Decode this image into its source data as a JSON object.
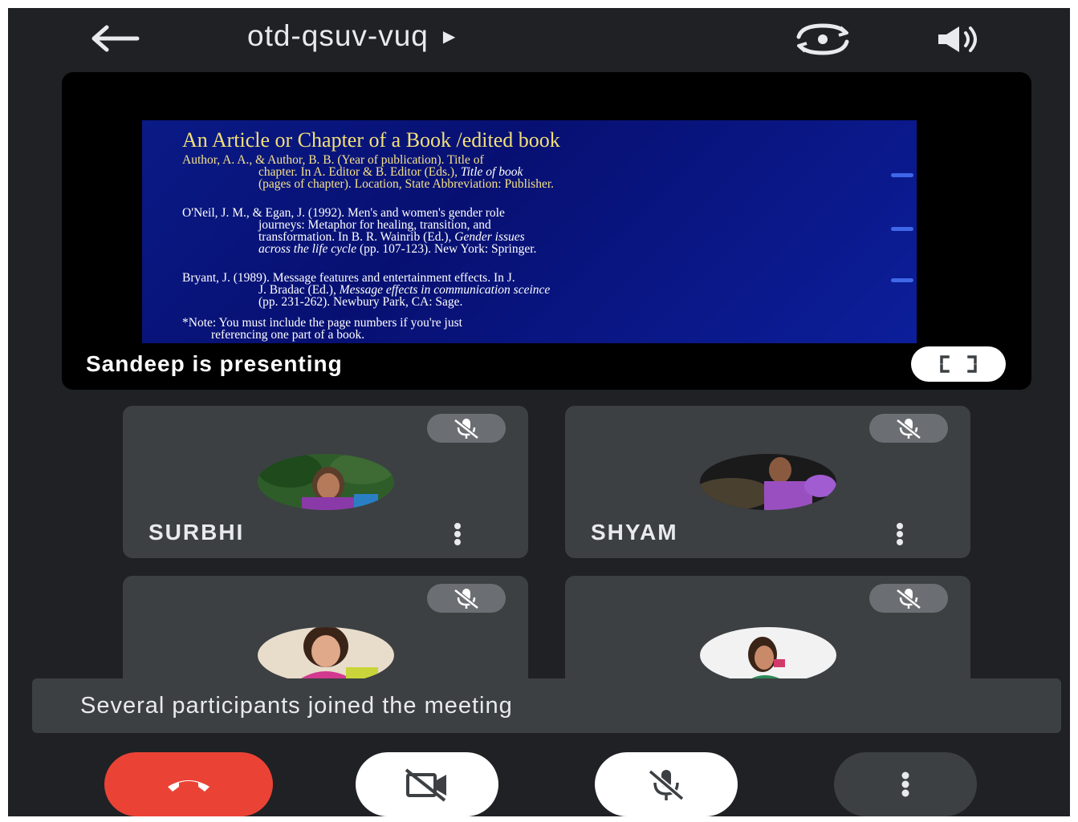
{
  "header": {
    "meeting_code": "otd-qsuv-vuq",
    "title_arrow": "▶",
    "back_icon": "arrow-left-icon",
    "switch_camera_icon": "switch-camera-icon",
    "speaker_icon": "volume-icon"
  },
  "presentation": {
    "slide": {
      "title": "An Article or Chapter of a Book /edited book",
      "ref1": {
        "l1": "Author, A. A., & Author, B. B. (Year of publication). Title of",
        "l2a": "chapter. In A. Editor & B. Editor (Eds.), ",
        "l2b": "Title of book",
        "l3": "(pages of chapter). Location, State Abbreviation: Publisher."
      },
      "ref2": {
        "l1": "O'Neil, J. M., & Egan, J. (1992). Men's and women's gender role",
        "l2": "journeys: Metaphor for healing, transition, and",
        "l3a": "transformation. In B. R. Wainrib (Ed.), ",
        "l3b": "Gender issues",
        "l4a": "across the life cycle",
        "l4b": " (pp. 107-123). New York: Springer."
      },
      "ref3": {
        "l1": "Bryant, J. (1989). Message features and entertainment effects. In J.",
        "l2a": "J. Bradac (Ed.), ",
        "l2b": "Message effects in communication sceince",
        "l3": "(pp. 231-262). Newbury Park, CA: Sage."
      },
      "note": {
        "l1": "*Note: You must include the page numbers if you're just",
        "l2": "referencing one part of a book."
      }
    },
    "presenter_label": "Sandeep is presenting",
    "fullscreen_icon": "fullscreen-icon"
  },
  "participants": [
    {
      "name": "SURBHI",
      "muted": true
    },
    {
      "name": "SHYAM",
      "muted": true
    },
    {
      "name": "",
      "muted": true
    },
    {
      "name": "",
      "muted": true
    }
  ],
  "toast": {
    "message": "Several participants joined the meeting"
  },
  "controls": {
    "end_call_icon": "end-call-icon",
    "camera_icon": "camera-off-icon",
    "mic_icon": "mic-off-icon",
    "more_icon": "more-vert-icon"
  },
  "colors": {
    "background": "#202124",
    "tile": "#3c4043",
    "end_call": "#ea4335",
    "slide_blue": "#0a1a86",
    "slide_title": "#f2e07a"
  }
}
